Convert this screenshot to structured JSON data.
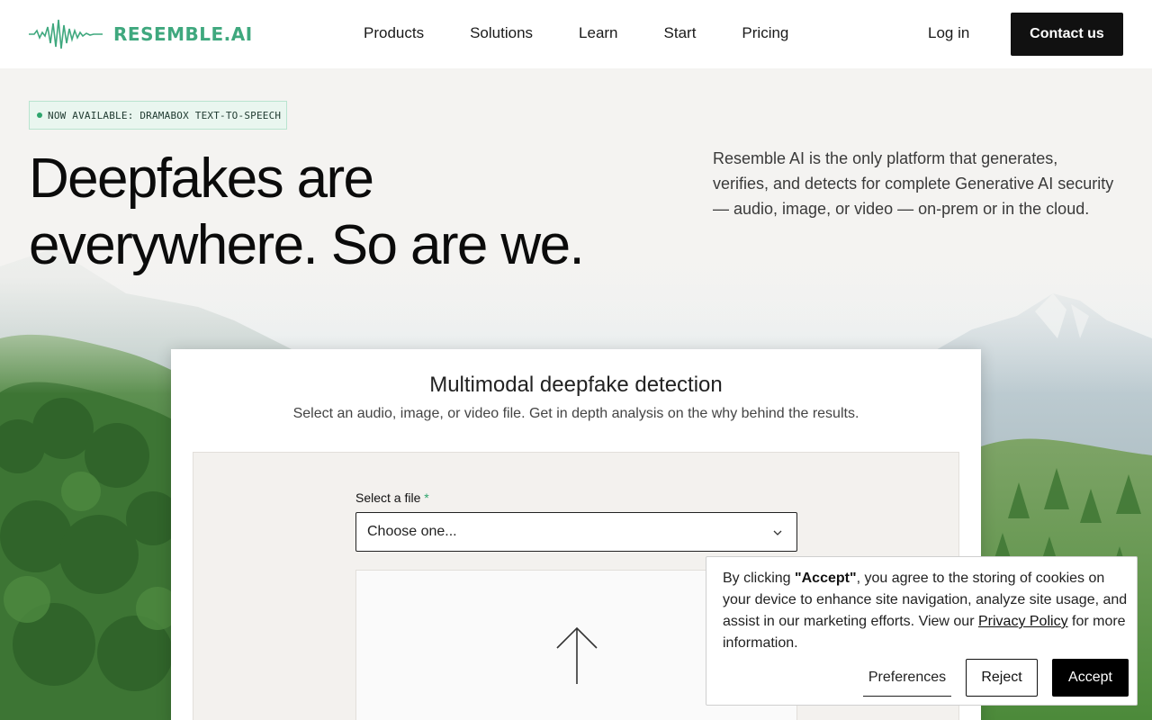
{
  "header": {
    "logo_text": "RESEMBLE.AI",
    "nav": [
      {
        "label": "Products"
      },
      {
        "label": "Solutions"
      },
      {
        "label": "Learn"
      },
      {
        "label": "Start"
      },
      {
        "label": "Pricing"
      }
    ],
    "login_label": "Log in",
    "contact_label": "Contact us"
  },
  "hero": {
    "badge": "NOW AVAILABLE: DRAMABOX TEXT-TO-SPEECH",
    "title": "Deepfakes are everywhere. So are we.",
    "description": "Resemble AI is the only platform that generates, verifies, and detects for complete Generative AI security — audio, image, or video — on-prem or in the cloud."
  },
  "detector": {
    "title": "Multimodal deepfake detection",
    "subtitle": "Select an audio, image, or video file. Get in depth analysis on the why behind the results.",
    "field_label": "Select a file",
    "required_mark": "*",
    "select_value": "Choose one..."
  },
  "cookie": {
    "text_prefix": "By clicking ",
    "accept_quote": "\"Accept\"",
    "text_middle": ", you agree to the storing of cookies on your device to enhance site navigation, analyze site usage, and assist in our marketing efforts. View our ",
    "policy_link": "Privacy Policy",
    "text_suffix": " for more information.",
    "preferences_label": "Preferences",
    "reject_label": "Reject",
    "accept_label": "Accept"
  },
  "colors": {
    "brand_green": "#3fa87e",
    "badge_bg": "#e9f6ef",
    "dark": "#111111"
  },
  "icons": [
    "waveform-logo-icon",
    "chevron-down-icon",
    "upload-arrow-icon"
  ]
}
